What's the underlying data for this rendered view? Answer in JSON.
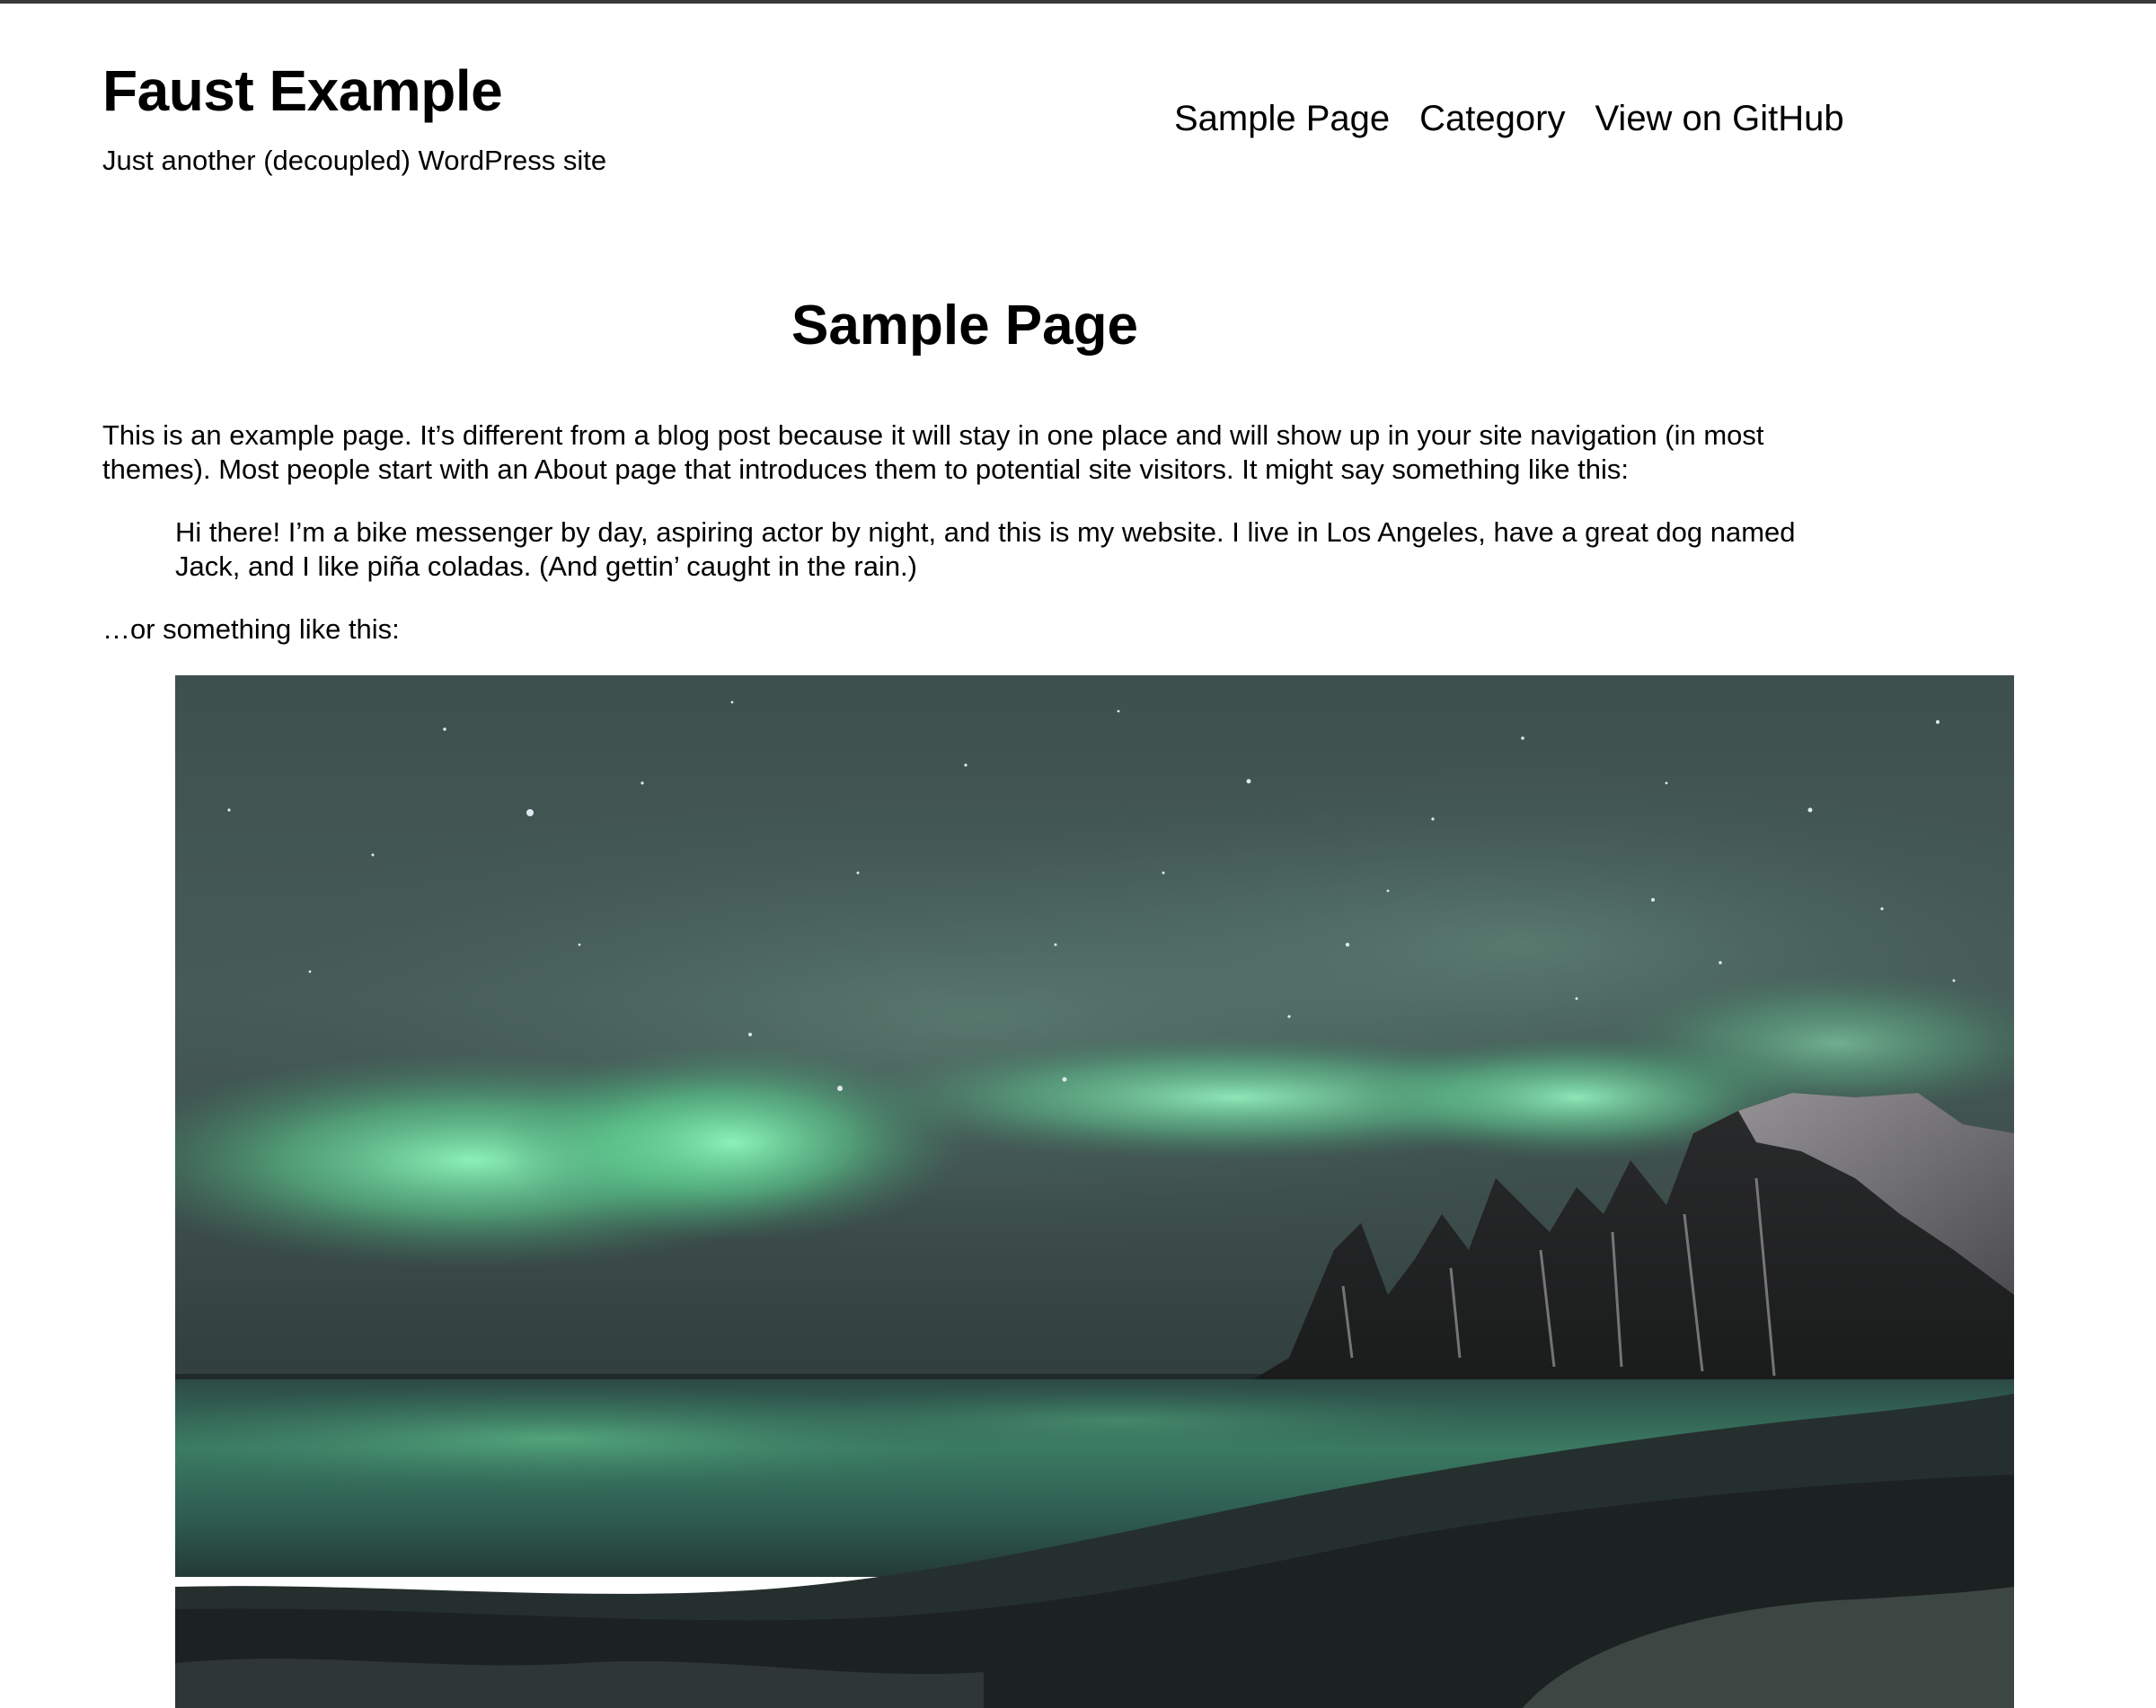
{
  "header": {
    "site_title": "Faust Example",
    "site_description": "Just another (decoupled) WordPress site"
  },
  "nav": {
    "items": [
      {
        "label": "Sample Page"
      },
      {
        "label": "Category"
      },
      {
        "label": "View on GitHub"
      }
    ]
  },
  "main": {
    "page_title": "Sample Page",
    "intro": "This is an example page. It’s different from a blog post because it will stay in one place and will show up in your site navigation (in most themes). Most people start with an About page that introduces them to potential site visitors. It might say something like this:",
    "quote": "Hi there! I’m a bike messenger by day, aspiring actor by night, and this is my website. I live in Los Angeles, have a great dog named Jack, and I like piña coladas. (And gettin’ caught in the rain.)",
    "outro": "…or something like this:"
  },
  "colors": {
    "top_rule": "#3a3a3a",
    "sky": "#3a4e4b",
    "aurora": "#7ff0b0",
    "water": "#2f6b5c",
    "rocks": "#1c1f1f"
  }
}
